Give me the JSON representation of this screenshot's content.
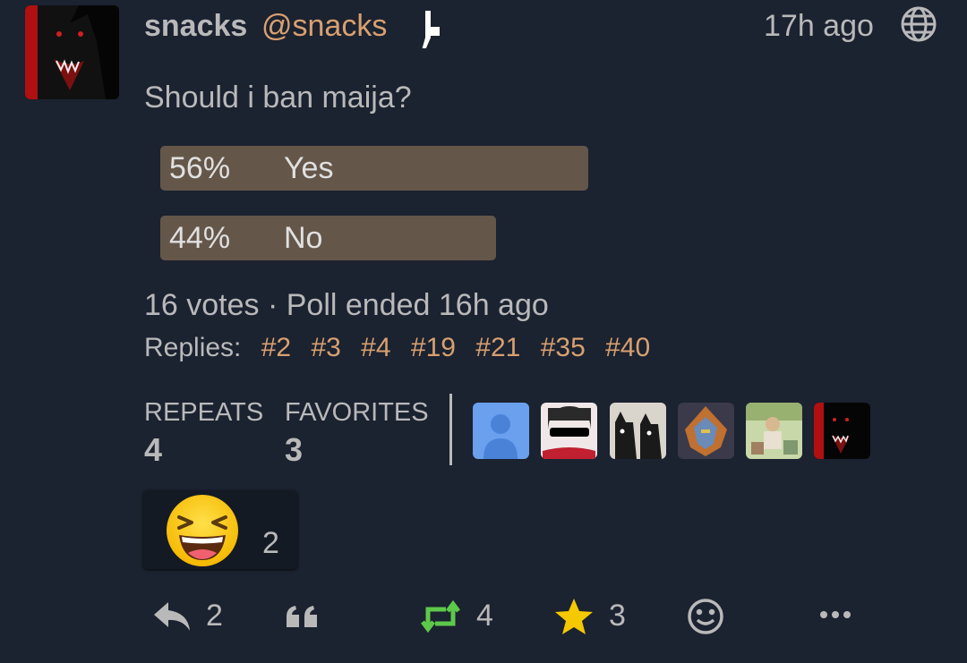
{
  "status": {
    "display_name": "snacks",
    "handle": "@snacks",
    "timestamp": "17h ago",
    "text": "Should i ban maija?"
  },
  "poll": {
    "options": [
      {
        "percent": "56%",
        "label": "Yes",
        "fraction": 0.56
      },
      {
        "percent": "44%",
        "label": "No",
        "fraction": 0.44
      }
    ],
    "meta": "16 votes · Poll ended 16h ago",
    "color": "#645749"
  },
  "replies": {
    "label": "Replies:",
    "links": [
      "#2",
      "#3",
      "#4",
      "#19",
      "#21",
      "#35",
      "#40"
    ]
  },
  "stats": {
    "repeats_label": "REPEATS",
    "repeats_value": "4",
    "favorites_label": "FAVORITES",
    "favorites_value": "3"
  },
  "reaction": {
    "emoji": "😆",
    "count": "2"
  },
  "actions": {
    "reply_count": "2",
    "repeat_count": "4",
    "favorite_count": "3"
  },
  "colors": {
    "background": "#1b2230",
    "text": "#b9b9ba",
    "link": "#d8a070",
    "repeat_green": "#5dc94a",
    "star_gold": "#f5c800"
  },
  "icons": [
    "bot-icon",
    "globe-icon",
    "reply-icon",
    "quote-icon",
    "repeat-icon",
    "star-icon",
    "emoji-react-icon",
    "more-icon"
  ]
}
